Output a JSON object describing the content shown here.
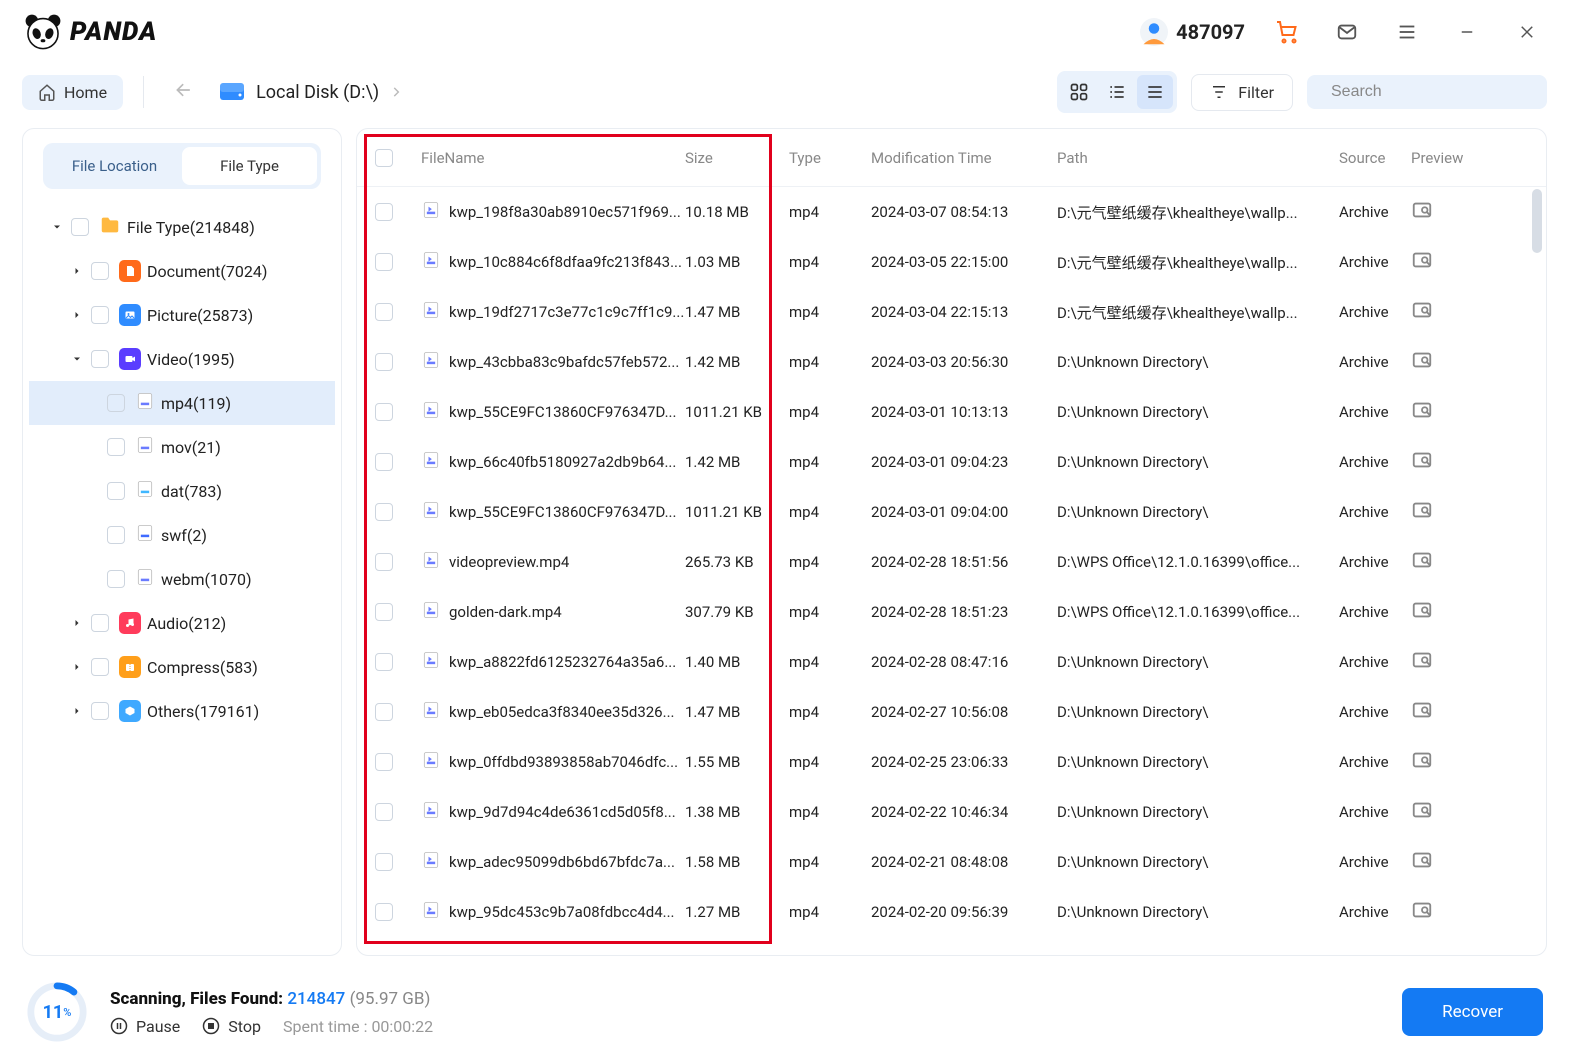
{
  "brand": "PANDA",
  "user": {
    "id": "487097"
  },
  "nav": {
    "home": "Home",
    "location": "Local Disk (D:\\)",
    "filter_label": "Filter",
    "search_placeholder": "Search"
  },
  "sidebar": {
    "tabs": [
      "File Location",
      "File Type"
    ],
    "active_tab": 1,
    "tree": [
      {
        "label": "File Type(214848)",
        "depth": 0,
        "expanded": true,
        "hasChildren": true,
        "icon": "folder",
        "color": "#ffb940"
      },
      {
        "label": "Document(7024)",
        "depth": 1,
        "expanded": false,
        "hasChildren": true,
        "icon": "doc",
        "color": "#ff6a1a"
      },
      {
        "label": "Picture(25873)",
        "depth": 1,
        "expanded": false,
        "hasChildren": true,
        "icon": "pic",
        "color": "#2f8cff"
      },
      {
        "label": "Video(1995)",
        "depth": 1,
        "expanded": true,
        "hasChildren": true,
        "icon": "vid",
        "color": "#5a3dff"
      },
      {
        "label": "mp4(119)",
        "depth": 2,
        "hasChildren": false,
        "selected": true,
        "icon": "file",
        "color": "#6a7bff"
      },
      {
        "label": "mov(21)",
        "depth": 2,
        "hasChildren": false,
        "icon": "file",
        "color": "#6a7bff"
      },
      {
        "label": "dat(783)",
        "depth": 2,
        "hasChildren": false,
        "icon": "file",
        "color": "#3fb7ff"
      },
      {
        "label": "swf(2)",
        "depth": 2,
        "hasChildren": false,
        "icon": "file",
        "color": "#3f6bff"
      },
      {
        "label": "webm(1070)",
        "depth": 2,
        "hasChildren": false,
        "icon": "file",
        "color": "#6a7bff"
      },
      {
        "label": "Audio(212)",
        "depth": 1,
        "expanded": false,
        "hasChildren": true,
        "icon": "aud",
        "color": "#ff3b5b"
      },
      {
        "label": "Compress(583)",
        "depth": 1,
        "expanded": false,
        "hasChildren": true,
        "icon": "zip",
        "color": "#ff9f1a"
      },
      {
        "label": "Others(179161)",
        "depth": 1,
        "expanded": false,
        "hasChildren": true,
        "icon": "oth",
        "color": "#3fa9ff"
      }
    ]
  },
  "columns": {
    "filename": "FileName",
    "size": "Size",
    "type": "Type",
    "mtime": "Modification Time",
    "path": "Path",
    "source": "Source",
    "preview": "Preview"
  },
  "rows": [
    {
      "name": "kwp_198f8a30ab8910ec571f969...",
      "size": "10.18 MB",
      "type": "mp4",
      "mtime": "2024-03-07 08:54:13",
      "path": "D:\\元气壁纸缓存\\khealtheye\\wallp...",
      "source": "Archive"
    },
    {
      "name": "kwp_10c884c6f8dfaa9fc213f843...",
      "size": "1.03 MB",
      "type": "mp4",
      "mtime": "2024-03-05 22:15:00",
      "path": "D:\\元气壁纸缓存\\khealtheye\\wallp...",
      "source": "Archive"
    },
    {
      "name": "kwp_19df2717c3e77c1c9c7ff1c9...",
      "size": "1.47 MB",
      "type": "mp4",
      "mtime": "2024-03-04 22:15:13",
      "path": "D:\\元气壁纸缓存\\khealtheye\\wallp...",
      "source": "Archive"
    },
    {
      "name": "kwp_43cbba83c9bafdc57feb572...",
      "size": "1.42 MB",
      "type": "mp4",
      "mtime": "2024-03-03 20:56:30",
      "path": "D:\\Unknown Directory\\",
      "source": "Archive"
    },
    {
      "name": "kwp_55CE9FC13860CF976347D...",
      "size": "1011.21 KB",
      "type": "mp4",
      "mtime": "2024-03-01 10:13:13",
      "path": "D:\\Unknown Directory\\",
      "source": "Archive"
    },
    {
      "name": "kwp_66c40fb5180927a2db9b64...",
      "size": "1.42 MB",
      "type": "mp4",
      "mtime": "2024-03-01 09:04:23",
      "path": "D:\\Unknown Directory\\",
      "source": "Archive"
    },
    {
      "name": "kwp_55CE9FC13860CF976347D...",
      "size": "1011.21 KB",
      "type": "mp4",
      "mtime": "2024-03-01 09:04:00",
      "path": "D:\\Unknown Directory\\",
      "source": "Archive"
    },
    {
      "name": "videopreview.mp4",
      "size": "265.73 KB",
      "type": "mp4",
      "mtime": "2024-02-28 18:51:56",
      "path": "D:\\WPS Office\\12.1.0.16399\\office...",
      "source": "Archive"
    },
    {
      "name": "golden-dark.mp4",
      "size": "307.79 KB",
      "type": "mp4",
      "mtime": "2024-02-28 18:51:23",
      "path": "D:\\WPS Office\\12.1.0.16399\\office...",
      "source": "Archive"
    },
    {
      "name": "kwp_a8822fd6125232764a35a6...",
      "size": "1.40 MB",
      "type": "mp4",
      "mtime": "2024-02-28 08:47:16",
      "path": "D:\\Unknown Directory\\",
      "source": "Archive"
    },
    {
      "name": "kwp_eb05edca3f8340ee35d326...",
      "size": "1.47 MB",
      "type": "mp4",
      "mtime": "2024-02-27 10:56:08",
      "path": "D:\\Unknown Directory\\",
      "source": "Archive"
    },
    {
      "name": "kwp_0ffdbd93893858ab7046dfc...",
      "size": "1.55 MB",
      "type": "mp4",
      "mtime": "2024-02-25 23:06:33",
      "path": "D:\\Unknown Directory\\",
      "source": "Archive"
    },
    {
      "name": "kwp_9d7d94c4de6361cd5d05f8...",
      "size": "1.38 MB",
      "type": "mp4",
      "mtime": "2024-02-22 10:46:34",
      "path": "D:\\Unknown Directory\\",
      "source": "Archive"
    },
    {
      "name": "kwp_adec95099db6bd67bfdc7a...",
      "size": "1.58 MB",
      "type": "mp4",
      "mtime": "2024-02-21 08:48:08",
      "path": "D:\\Unknown Directory\\",
      "source": "Archive"
    },
    {
      "name": "kwp_95dc453c9b7a08fdbcc4d4...",
      "size": "1.27 MB",
      "type": "mp4",
      "mtime": "2024-02-20 09:56:39",
      "path": "D:\\Unknown Directory\\",
      "source": "Archive"
    }
  ],
  "footer": {
    "percent": "11",
    "percent_suffix": "%",
    "scanning_label": "Scanning, Files Found:",
    "files_found": "214847",
    "total_size": "(95.97 GB)",
    "pause": "Pause",
    "stop": "Stop",
    "spent_label": "Spent time :",
    "spent_value": "00:00:22",
    "recover": "Recover"
  }
}
